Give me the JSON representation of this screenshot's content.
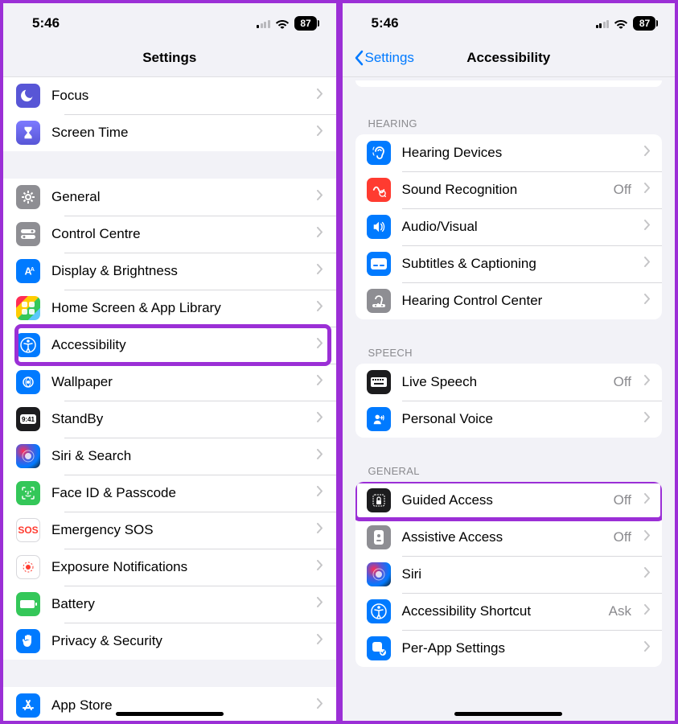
{
  "left": {
    "status": {
      "time": "5:46",
      "battery": "87"
    },
    "nav_title": "Settings",
    "group1": [
      {
        "icon": "moon-icon",
        "bg": "bg-purple",
        "label": "Focus"
      },
      {
        "icon": "hourglass-icon",
        "bg": "bg-grad-purple",
        "label": "Screen Time"
      }
    ],
    "group2": [
      {
        "icon": "gear-icon",
        "bg": "bg-grey",
        "label": "General"
      },
      {
        "icon": "toggles-icon",
        "bg": "bg-grey",
        "label": "Control Centre"
      },
      {
        "icon": "brightness-icon",
        "bg": "bg-blue",
        "label": "Display & Brightness"
      },
      {
        "icon": "apps-icon",
        "bg": "bg-multicolor",
        "label": "Home Screen & App Library"
      },
      {
        "icon": "accessibility-icon",
        "bg": "bg-blue",
        "label": "Accessibility"
      },
      {
        "icon": "wallpaper-icon",
        "bg": "bg-blue",
        "label": "Wallpaper"
      },
      {
        "icon": "standby-icon",
        "bg": "bg-dark",
        "label": "StandBy"
      },
      {
        "icon": "siri-icon",
        "bg": "bg-siri",
        "label": "Siri & Search"
      },
      {
        "icon": "faceid-icon",
        "bg": "bg-green",
        "label": "Face ID & Passcode"
      },
      {
        "icon": "sos-icon",
        "bg": "bg-white",
        "label": "Emergency SOS"
      },
      {
        "icon": "exposure-icon",
        "bg": "bg-white",
        "label": "Exposure Notifications"
      },
      {
        "icon": "battery-icon",
        "bg": "bg-green",
        "label": "Battery"
      },
      {
        "icon": "hand-icon",
        "bg": "bg-blue",
        "label": "Privacy & Security"
      }
    ],
    "group3": [
      {
        "icon": "appstore-icon",
        "bg": "bg-blue",
        "label": "App Store"
      }
    ],
    "highlight_index": 4
  },
  "right": {
    "status": {
      "time": "5:46",
      "battery": "87"
    },
    "nav_back": "Settings",
    "nav_title": "Accessibility",
    "sections": [
      {
        "header": "HEARING",
        "items": [
          {
            "icon": "ear-icon",
            "bg": "bg-blue",
            "label": "Hearing Devices",
            "value": ""
          },
          {
            "icon": "sound-icon",
            "bg": "bg-red",
            "label": "Sound Recognition",
            "value": "Off"
          },
          {
            "icon": "audio-icon",
            "bg": "bg-blue",
            "label": "Audio/Visual",
            "value": ""
          },
          {
            "icon": "captions-icon",
            "bg": "bg-blue",
            "label": "Subtitles & Captioning",
            "value": ""
          },
          {
            "icon": "hearing-ctrl-icon",
            "bg": "bg-grey",
            "label": "Hearing Control Center",
            "value": ""
          }
        ]
      },
      {
        "header": "SPEECH",
        "items": [
          {
            "icon": "keyboard-icon",
            "bg": "bg-dark",
            "label": "Live Speech",
            "value": "Off"
          },
          {
            "icon": "voice-icon",
            "bg": "bg-blue",
            "label": "Personal Voice",
            "value": ""
          }
        ]
      },
      {
        "header": "GENERAL",
        "items": [
          {
            "icon": "lock-icon",
            "bg": "bg-dark",
            "label": "Guided Access",
            "value": "Off"
          },
          {
            "icon": "assist-icon",
            "bg": "bg-grey",
            "label": "Assistive Access",
            "value": "Off"
          },
          {
            "icon": "siri-icon",
            "bg": "bg-siri",
            "label": "Siri",
            "value": ""
          },
          {
            "icon": "shortcut-icon",
            "bg": "bg-blue",
            "label": "Accessibility Shortcut",
            "value": "Ask"
          },
          {
            "icon": "perapp-icon",
            "bg": "bg-blue",
            "label": "Per-App Settings",
            "value": ""
          }
        ]
      }
    ],
    "highlight": {
      "section": 2,
      "index": 0
    }
  }
}
